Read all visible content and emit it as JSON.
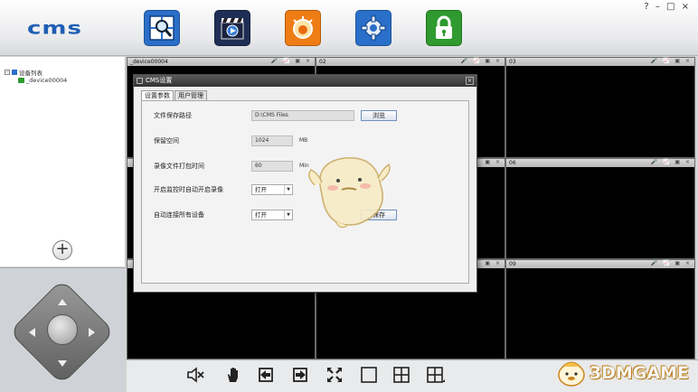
{
  "app": {
    "logo": "cms"
  },
  "window_controls": "? – □ ×",
  "toolbar": {
    "buttons": [
      {
        "name": "preview-layout",
        "icon": "grid-search-icon",
        "color": "#2a6fc9"
      },
      {
        "name": "playback",
        "icon": "clapperboard-icon",
        "color": "#1e2e55"
      },
      {
        "name": "alarm",
        "icon": "alarm-icon",
        "color": "#ef7d16"
      },
      {
        "name": "settings",
        "icon": "gear-icon",
        "color": "#2a6fc9"
      },
      {
        "name": "lock",
        "icon": "lock-icon",
        "color": "#2f9a2f"
      }
    ]
  },
  "tree": {
    "root_label": "设备列表",
    "device_label": "_device00004"
  },
  "cells": [
    {
      "title": "_device00004",
      "icons": "🎤 📈 ▣ ×"
    },
    {
      "title": "02",
      "icons": "🎤 📈 ▣ ×"
    },
    {
      "title": "03",
      "icons": "🎤 📈 ▣ ×"
    },
    {
      "title": "",
      "icons": ""
    },
    {
      "title": "",
      "icons": "▣ ×"
    },
    {
      "title": "06",
      "icons": "🎤 📈 ▣ ×"
    },
    {
      "title": "",
      "icons": ""
    },
    {
      "title": "",
      "icons": "▣ ×"
    },
    {
      "title": "09",
      "icons": "🎤 📈 ▣ ×"
    }
  ],
  "dialog": {
    "title": "CMS设置",
    "close": "×",
    "tabs": [
      "设置参数",
      "用户管理"
    ],
    "fields": {
      "save_path": {
        "label": "文件保存路径",
        "value": "D:\\CMS Files",
        "button": "浏览"
      },
      "reserved_space": {
        "label": "保留空间",
        "value": "1024",
        "unit": "MB"
      },
      "record_pack_time": {
        "label": "录像文件打包时间",
        "value": "60",
        "unit": "Min"
      },
      "auto_record": {
        "label": "开启监控时自动开启录像",
        "value": "打开"
      },
      "auto_connect": {
        "label": "自动连接所有设备",
        "value": "打开"
      }
    },
    "save_button": "保存"
  },
  "bottom_bar": {
    "icons": [
      "mute-icon",
      "hand-icon",
      "previous-page-icon",
      "next-page-icon",
      "fullscreen-icon",
      "single-view-icon",
      "quad-view-icon",
      "multi-view-icon"
    ]
  },
  "watermark": {
    "text": "3DMGAME"
  }
}
